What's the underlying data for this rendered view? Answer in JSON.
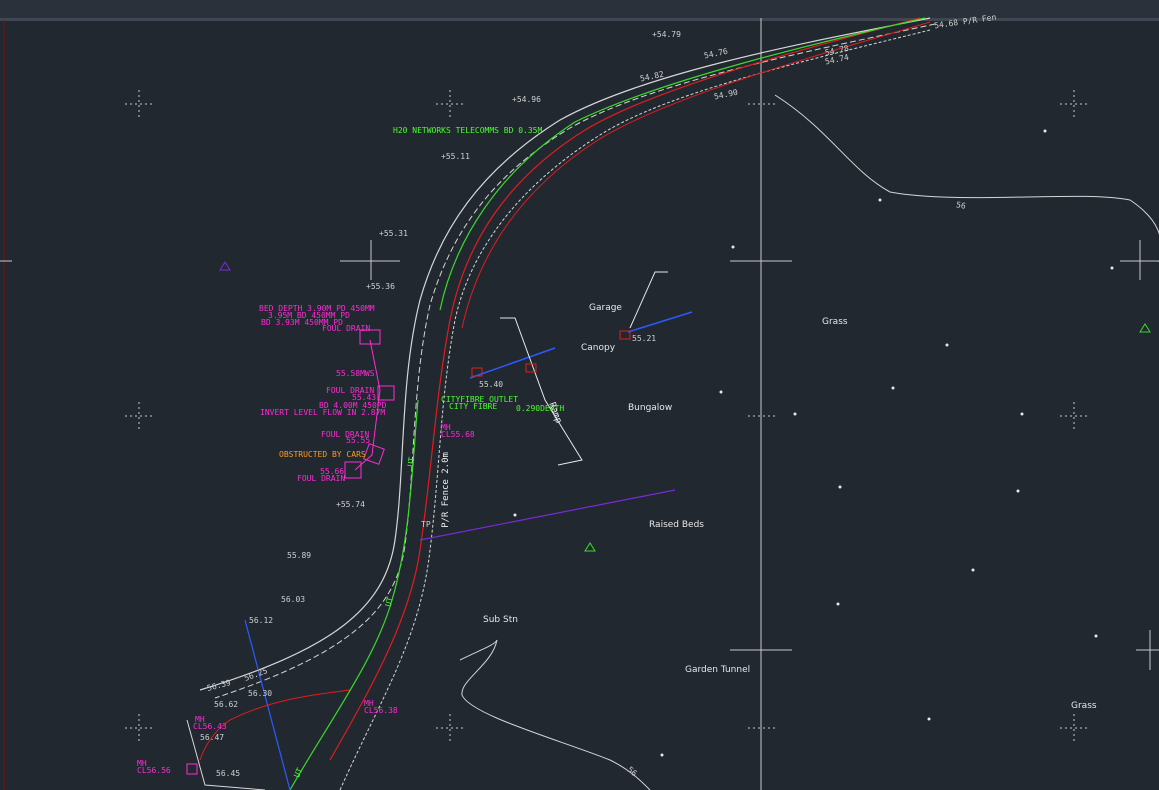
{
  "window": {
    "title": ""
  },
  "colors": {
    "background": "#212830",
    "linework": "#d6d6d6",
    "cable_red": "#e11d1d",
    "cable_green": "#3ad92a",
    "drainage": "#ff2bd6",
    "water_blue": "#2b5bff",
    "boundary_purple": "#7a2bd6",
    "note_orange": "#ff9a1f",
    "crosshair": "#c9c9c9"
  },
  "area_labels": [
    {
      "id": "garage",
      "text": "Garage"
    },
    {
      "id": "canopy",
      "text": "Canopy"
    },
    {
      "id": "bungalow",
      "text": "Bungalow"
    },
    {
      "id": "grass-1",
      "text": "Grass"
    },
    {
      "id": "grass-2",
      "text": "Grass"
    },
    {
      "id": "raised-beds",
      "text": "Raised Beds"
    },
    {
      "id": "sub-stn",
      "text": "Sub Stn"
    },
    {
      "id": "garden-tunnel",
      "text": "Garden Tunnel"
    }
  ],
  "drainage_notes": [
    {
      "id": "bed-depth",
      "text": "BED DEPTH 3.90M PD 450MM"
    },
    {
      "id": "bd-1",
      "text": "3.95M BD 450MM PD"
    },
    {
      "id": "bd-2",
      "text": "BD 3.93M 450MM PD"
    },
    {
      "id": "foul-drain-1",
      "text": "FOUL DRAIN"
    },
    {
      "id": "level-5558",
      "text": "55.58MWS"
    },
    {
      "id": "foul-drain-2",
      "text": "FOUL DRAIN"
    },
    {
      "id": "level-5543",
      "text": "55.43"
    },
    {
      "id": "bd-400",
      "text": "BD 4.00M 450PD"
    },
    {
      "id": "invert",
      "text": "INVERT LEVEL FLOW IN 2.87M"
    },
    {
      "id": "foul-drain-3",
      "text": "FOUL DRAIN"
    },
    {
      "id": "level-5555",
      "text": "55.55"
    },
    {
      "id": "level-5566",
      "text": "55.66"
    },
    {
      "id": "foul-drain-4",
      "text": "FOUL DRAIN"
    },
    {
      "id": "mh-1",
      "text": "MH"
    },
    {
      "id": "cl-5643",
      "text": "CL56.43"
    },
    {
      "id": "mh-2",
      "text": "MH"
    },
    {
      "id": "cl-5656",
      "text": "CL56.56"
    },
    {
      "id": "mh-3",
      "text": "MH"
    },
    {
      "id": "cl-5638",
      "text": "CL56.38"
    },
    {
      "id": "mh-4",
      "text": "MH"
    },
    {
      "id": "cl-5568",
      "text": "CL55.68"
    }
  ],
  "green_notes": [
    {
      "id": "h20",
      "text": "H20 NETWORKS TELECOMMS BD 0.35M"
    },
    {
      "id": "city-fibre",
      "text": "CITYFIBRE OUTLET"
    },
    {
      "id": "city-fibre-2",
      "text": "CITY FIBRE"
    },
    {
      "id": "depth-0290",
      "text": "0.290DEPTH"
    },
    {
      "id": "ut-1",
      "text": "UT"
    },
    {
      "id": "ut-2",
      "text": "UT"
    },
    {
      "id": "ut-3",
      "text": "UT"
    }
  ],
  "orange_notes": [
    {
      "id": "obstructed",
      "text": "OBSTRUCTED BY CARS"
    }
  ],
  "spot_levels": [
    {
      "id": "l-5479",
      "text": "+54.79"
    },
    {
      "id": "l-5496",
      "text": "+54.96"
    },
    {
      "id": "l-5511",
      "text": "+55.11"
    },
    {
      "id": "l-5531",
      "text": "+55.31"
    },
    {
      "id": "l-5536",
      "text": "+55.36"
    },
    {
      "id": "l-5574",
      "text": "+55.74"
    },
    {
      "id": "l-5589",
      "text": "55.89"
    },
    {
      "id": "l-5603",
      "text": "56.03"
    },
    {
      "id": "l-5612",
      "text": "56.12"
    },
    {
      "id": "l-5476",
      "text": "54.76"
    },
    {
      "id": "l-5482",
      "text": "54.82"
    },
    {
      "id": "l-5490",
      "text": "54.90"
    },
    {
      "id": "l-5478",
      "text": "54.78"
    },
    {
      "id": "l-5474",
      "text": "54.74"
    },
    {
      "id": "l-5540",
      "text": "55.40"
    },
    {
      "id": "l-5521",
      "text": "55.21"
    },
    {
      "id": "l-5639",
      "text": "56.39"
    },
    {
      "id": "l-5630",
      "text": "56.30"
    },
    {
      "id": "l-5662",
      "text": "56.62"
    },
    {
      "id": "l-5647",
      "text": "56.47"
    },
    {
      "id": "l-5645",
      "text": "56.45"
    },
    {
      "id": "l-5625",
      "text": "56.25"
    }
  ],
  "other_text": [
    {
      "id": "fence",
      "text": "P/R Fence 2.0m"
    },
    {
      "id": "ramp",
      "text": "Ramp"
    },
    {
      "id": "tp",
      "text": "TP"
    },
    {
      "id": "contour-56",
      "text": "56"
    },
    {
      "id": "contour-56b",
      "text": "56"
    },
    {
      "id": "fence-top",
      "text": "54.68 P/R Fen"
    }
  ]
}
